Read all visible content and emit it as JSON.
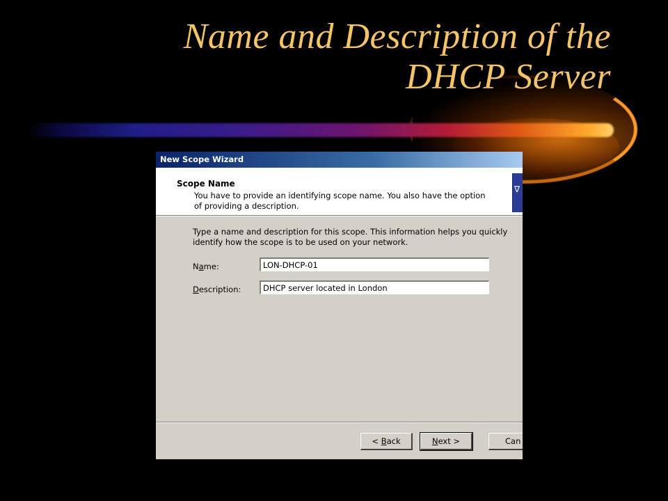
{
  "slide": {
    "title_line1": "Name and Description of the",
    "title_line2": "DHCP Server",
    "title_color": "#f4c46a"
  },
  "wizard": {
    "window_title": "New Scope Wizard",
    "header_title": "Scope Name",
    "header_subtitle": "You have to provide an identifying scope name. You also have the option of providing a description.",
    "instructions": "Type a name and description for this scope. This information helps you quickly identify how the scope is to be used on your network.",
    "name_label_before": "N",
    "name_label_mnemonic": "a",
    "name_label_after": "me:",
    "name_value": "LON-DHCP-01",
    "description_label_mnemonic": "D",
    "description_label_after": "escription:",
    "description_value": "DHCP server located in London",
    "back_mnemonic": "B",
    "back_after": "ack",
    "next_mnemonic": "N",
    "next_after": "ext >",
    "cancel_label": "Can",
    "header_icon": "wizard-logo-icon"
  }
}
